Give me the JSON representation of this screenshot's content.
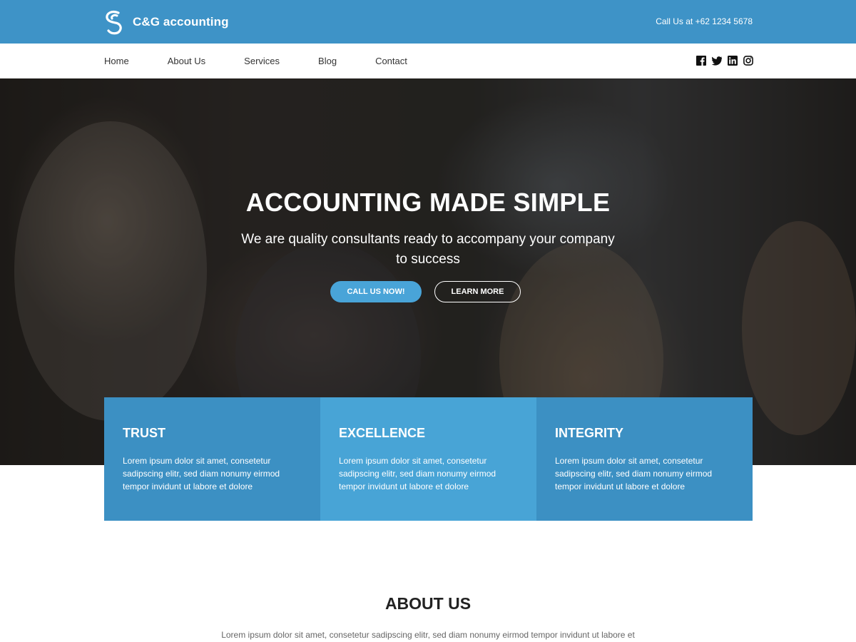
{
  "header": {
    "brand_name": "C&G accounting",
    "call_text": "Call Us at +62 1234 5678"
  },
  "nav": {
    "items": [
      {
        "label": "Home"
      },
      {
        "label": "About Us"
      },
      {
        "label": "Services"
      },
      {
        "label": "Blog"
      },
      {
        "label": "Contact"
      }
    ],
    "social": [
      "facebook-icon",
      "twitter-icon",
      "linkedin-icon",
      "instagram-icon"
    ]
  },
  "hero": {
    "title": "ACCOUNTING MADE SIMPLE",
    "subtitle": "We are quality consultants ready to accompany your company to success",
    "primary_button": "CALL US NOW!",
    "secondary_button": "LEARN MORE"
  },
  "features": [
    {
      "title": "TRUST",
      "text": "Lorem ipsum dolor sit amet, consetetur sadipscing elitr, sed diam nonumy eirmod tempor invidunt ut labore et dolore"
    },
    {
      "title": "EXCELLENCE",
      "text": "Lorem ipsum dolor sit amet, consetetur sadipscing elitr, sed diam nonumy eirmod tempor invidunt ut labore et dolore"
    },
    {
      "title": "INTEGRITY",
      "text": "Lorem ipsum dolor sit amet, consetetur sadipscing elitr, sed diam nonumy eirmod tempor invidunt ut labore et dolore"
    }
  ],
  "about": {
    "title": "ABOUT US",
    "text": "Lorem ipsum dolor sit amet, consetetur sadipscing elitr, sed diam nonumy eirmod tempor invidunt ut labore et"
  },
  "colors": {
    "primary": "#3e93c7",
    "accent": "#49a4d8",
    "feature_dark": "#3c90c3",
    "feature_light": "#48a4d6"
  }
}
